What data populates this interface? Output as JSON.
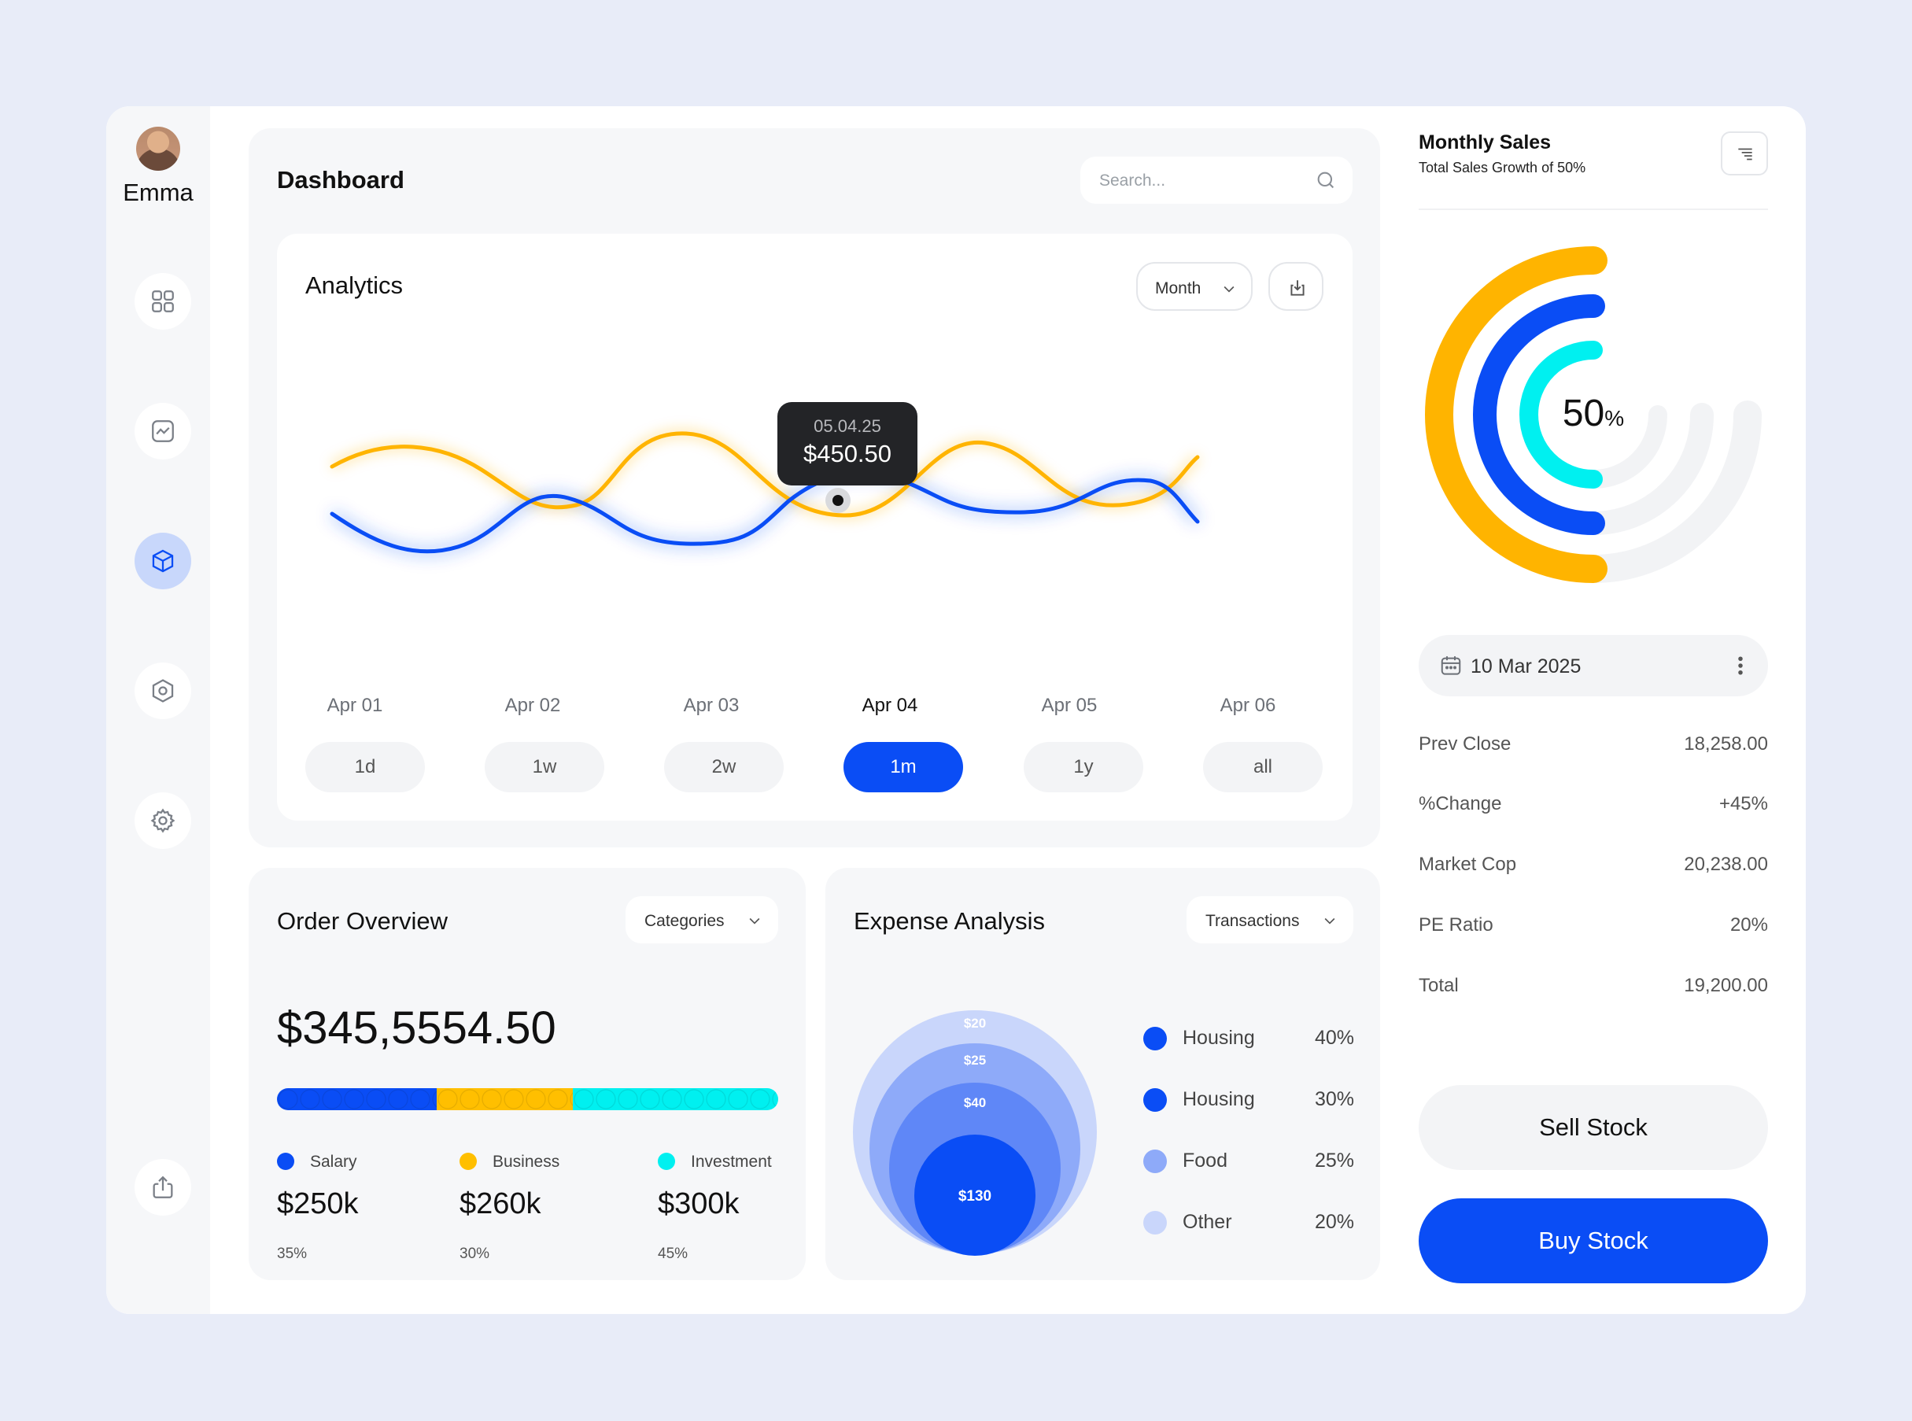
{
  "user": {
    "name": "Emma"
  },
  "sidebar": {
    "items": [
      {
        "icon": "grid-icon"
      },
      {
        "icon": "chart-icon"
      },
      {
        "icon": "cube-icon",
        "active": true
      },
      {
        "icon": "hexagon-icon"
      },
      {
        "icon": "settings-icon"
      }
    ],
    "bottom_icon": "share-icon"
  },
  "dashboard": {
    "title": "Dashboard",
    "search": {
      "placeholder": "Search..."
    }
  },
  "analytics": {
    "title": "Analytics",
    "period_dropdown": "Month",
    "tooltip": {
      "date": "05.04.25",
      "value": "$450.50"
    },
    "x_labels": [
      "Apr 01",
      "Apr 02",
      "Apr 03",
      "Apr 04",
      "Apr 05",
      "Apr 06"
    ],
    "active_x_label": "Apr 04",
    "ranges": [
      "1d",
      "1w",
      "2w",
      "1m",
      "1y",
      "all"
    ],
    "active_range": "1m",
    "colors": {
      "series_a": "#ffb400",
      "series_b": "#0a4df5"
    }
  },
  "order_overview": {
    "title": "Order Overview",
    "dropdown": "Categories",
    "total": "$345,5554.50",
    "items": [
      {
        "name": "Salary",
        "amount": "$250k",
        "percent": "35%",
        "share": 0.35,
        "color": "#0a4df5"
      },
      {
        "name": "Business",
        "amount": "$260k",
        "percent": "30%",
        "share": 0.3,
        "color": "#ffbf00"
      },
      {
        "name": "Investment",
        "amount": "$300k",
        "percent": "45%",
        "share": 0.45,
        "color": "#00f0f0"
      }
    ]
  },
  "expense_analysis": {
    "title": "Expense Analysis",
    "dropdown": "Transactions",
    "bubbles": [
      "$20",
      "$25",
      "$40",
      "$130"
    ],
    "legend": [
      {
        "name": "Housing",
        "percent": "40%",
        "color": "#0a4df5"
      },
      {
        "name": "Housing",
        "percent": "30%",
        "color": "#0a4df5"
      },
      {
        "name": "Food",
        "percent": "25%",
        "color": "#8eaaf9"
      },
      {
        "name": "Other",
        "percent": "20%",
        "color": "#c9d6fb"
      }
    ]
  },
  "monthly_sales": {
    "title": "Monthly Sales",
    "subtitle": "Total Sales Growth of 50%",
    "center_value": "50",
    "center_unit": "%",
    "ring_colors": [
      "#ffb400",
      "#0a4df5",
      "#00f0f0"
    ],
    "date": "10 Mar 2025",
    "stats": [
      {
        "label": "Prev Close",
        "value": "18,258.00"
      },
      {
        "label": "%Change",
        "value": "+45%"
      },
      {
        "label": "Market Cop",
        "value": "20,238.00"
      },
      {
        "label": "PE Ratio",
        "value": "20%"
      },
      {
        "label": "Total",
        "value": "19,200.00"
      }
    ],
    "sell_label": "Sell Stock",
    "buy_label": "Buy Stock"
  }
}
